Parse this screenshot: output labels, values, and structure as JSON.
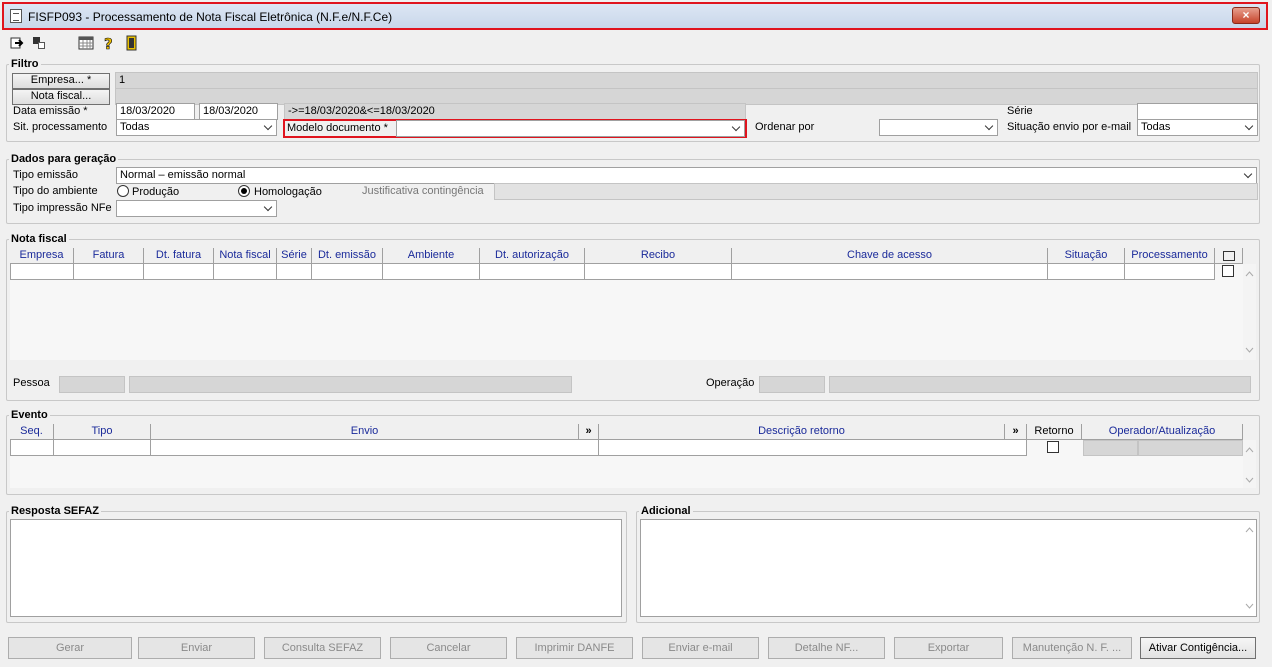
{
  "window": {
    "title": "FISFP093 - Processamento de Nota Fiscal Eletrônica (N.F.e/N.F.Ce)",
    "close_label": "×"
  },
  "toolbar": {
    "icons": [
      "exit-icon",
      "layout-icon",
      "calendar-grid-icon",
      "help-icon",
      "door-exit-icon"
    ]
  },
  "filtro": {
    "legend": "Filtro",
    "empresa_button": "Empresa... *",
    "empresa_value": "1",
    "nota_fiscal_button": "Nota fiscal...",
    "data_emissao_label": "Data emissão *",
    "data_inicio": "18/03/2020",
    "data_fim": "18/03/2020",
    "data_expr": "->=18/03/2020&<=18/03/2020",
    "serie_label": "Série",
    "sit_processamento_label": "Sit. processamento",
    "sit_processamento_value": "Todas",
    "modelo_documento_label": "Modelo documento *",
    "ordenar_por_label": "Ordenar por",
    "situacao_envio_label": "Situação envio por e-mail",
    "situacao_envio_value": "Todas"
  },
  "dados": {
    "legend": "Dados para geração",
    "tipo_emissao_label": "Tipo emissão",
    "tipo_emissao_value": "Normal – emissão normal",
    "tipo_ambiente_label": "Tipo do ambiente",
    "producao_label": "Produção",
    "homologacao_label": "Homologação",
    "justificativa_label": "Justificativa contingência",
    "tipo_impressao_label": "Tipo impressão NFe"
  },
  "nota_fiscal": {
    "legend": "Nota fiscal",
    "columns": [
      "Empresa",
      "Fatura",
      "Dt. fatura",
      "Nota fiscal",
      "Série",
      "Dt. emissão",
      "Ambiente",
      "Dt. autorização",
      "Recibo",
      "Chave de acesso",
      "Situação",
      "Processamento"
    ],
    "pessoa_label": "Pessoa",
    "operacao_label": "Operação"
  },
  "evento": {
    "legend": "Evento",
    "columns": [
      "Seq.",
      "Tipo",
      "Envio",
      "»",
      "Descrição retorno",
      "»",
      "Retorno",
      "Operador/Atualização"
    ]
  },
  "resposta": {
    "legend": "Resposta SEFAZ"
  },
  "adicional": {
    "legend": "Adicional"
  },
  "buttons": [
    "Gerar",
    "Enviar",
    "Consulta SEFAZ",
    "Cancelar",
    "Imprimir DANFE",
    "Enviar e-mail",
    "Detalhe NF...",
    "Exportar",
    "Manutenção N. F. ...",
    "Ativar Contigência..."
  ]
}
